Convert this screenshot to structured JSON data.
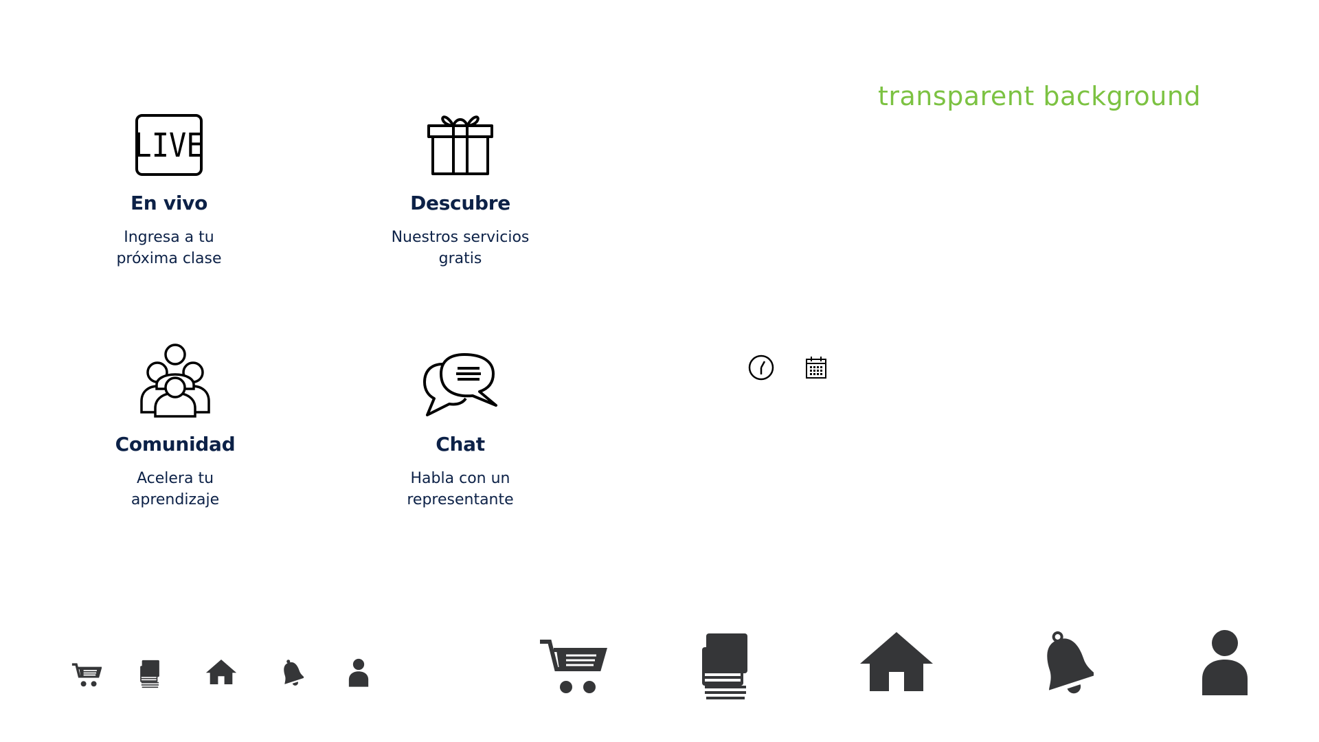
{
  "tagline": "transparent background",
  "colors": {
    "navy": "#0c2147",
    "green": "#7cc242",
    "icon_gray": "#353638"
  },
  "cards": [
    {
      "icon": "live-icon",
      "title": "En vivo",
      "description": "Ingresa a tu\npróxima clase"
    },
    {
      "icon": "gift-icon",
      "title": "Descubre",
      "description": "Nuestros servicios\ngratis"
    },
    {
      "icon": "community-icon",
      "title": "Comunidad",
      "description": "Acelera tu\naprendizaje"
    },
    {
      "icon": "chat-icon",
      "title": "Chat",
      "description": "Habla con un\nrepresentante"
    }
  ],
  "small_icons": [
    "clock-icon",
    "calendar-icon"
  ],
  "nav_icons_small": [
    "cart-icon",
    "book-icon",
    "home-icon",
    "bell-icon",
    "user-icon"
  ],
  "nav_icons_large": [
    "cart-icon",
    "book-icon",
    "home-icon",
    "bell-icon",
    "user-icon"
  ]
}
